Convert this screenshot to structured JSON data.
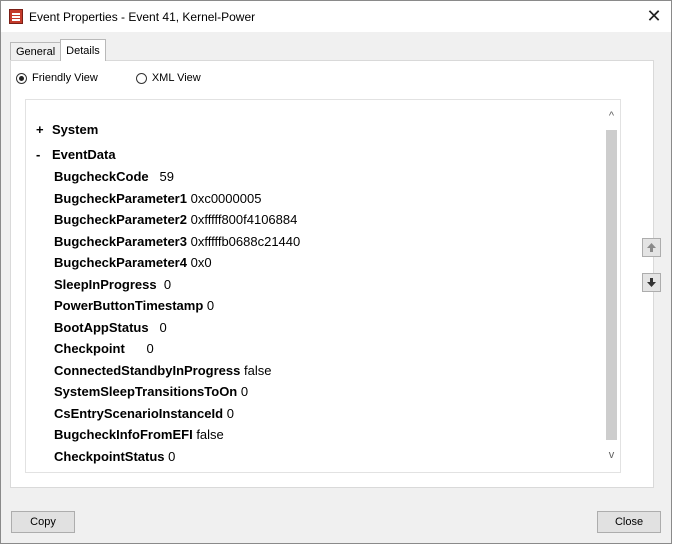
{
  "window": {
    "title": "Event Properties - Event 41, Kernel-Power",
    "close_glyph": "✕"
  },
  "tabs": [
    {
      "label": "General",
      "active": false
    },
    {
      "label": "Details",
      "active": true
    }
  ],
  "view_options": {
    "friendly": {
      "label": "Friendly View",
      "selected": true
    },
    "xml": {
      "label": "XML View",
      "selected": false
    }
  },
  "tree": {
    "system": {
      "sign": "+",
      "label": "System"
    },
    "eventdata": {
      "sign": "-",
      "label": "EventData"
    },
    "fields": [
      {
        "key": "BugcheckCode",
        "value": "59",
        "gap": "   "
      },
      {
        "key": "BugcheckParameter1",
        "value": "0xc0000005",
        "gap": " "
      },
      {
        "key": "BugcheckParameter2",
        "value": "0xfffff800f4106884",
        "gap": " "
      },
      {
        "key": "BugcheckParameter3",
        "value": "0xfffffb0688c21440",
        "gap": " "
      },
      {
        "key": "BugcheckParameter4",
        "value": "0x0",
        "gap": " "
      },
      {
        "key": "SleepInProgress",
        "value": "0",
        "gap": "  "
      },
      {
        "key": "PowerButtonTimestamp",
        "value": "0",
        "gap": " "
      },
      {
        "key": "BootAppStatus",
        "value": "0",
        "gap": "   "
      },
      {
        "key": "Checkpoint",
        "value": "0",
        "gap": "      "
      },
      {
        "key": "ConnectedStandbyInProgress",
        "value": "false",
        "gap": " "
      },
      {
        "key": "SystemSleepTransitionsToOn",
        "value": "0",
        "gap": " "
      },
      {
        "key": "CsEntryScenarioInstanceId",
        "value": "0",
        "gap": " "
      },
      {
        "key": "BugcheckInfoFromEFI",
        "value": "false",
        "gap": " "
      },
      {
        "key": "CheckpointStatus",
        "value": "0",
        "gap": " "
      }
    ]
  },
  "scrollbar": {
    "up_glyph": "^",
    "down_glyph": "v"
  },
  "nav": {
    "up_icon": "arrow-up-icon",
    "down_icon": "arrow-down-icon"
  },
  "buttons": {
    "copy": "Copy",
    "close": "Close"
  },
  "colors": {
    "panel_bg": "#f0f0f0",
    "viewer_bg": "#ffffff",
    "scroll_thumb": "#cdcdcd"
  }
}
